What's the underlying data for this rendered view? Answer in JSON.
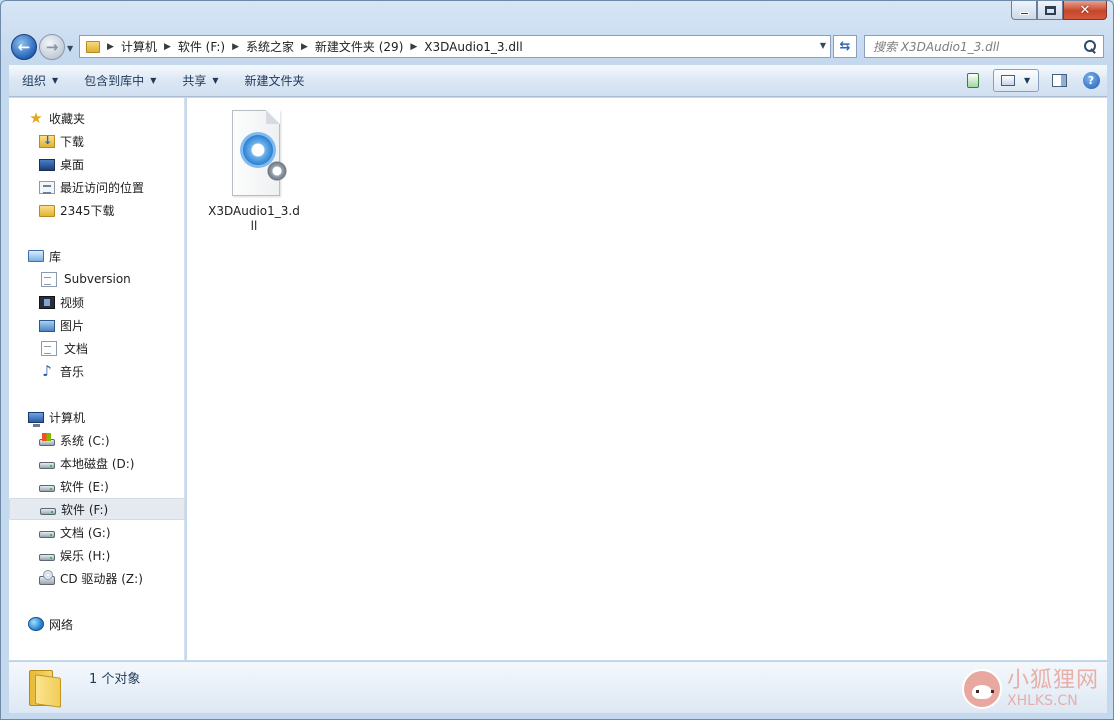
{
  "caption": {
    "min_glyph": "–",
    "max_glyph": "□",
    "close_glyph": "✕"
  },
  "address": {
    "crumbs": [
      "计算机",
      "软件 (F:)",
      "系统之家",
      "新建文件夹 (29)",
      "X3DAudio1_3.dll"
    ]
  },
  "search": {
    "placeholder": "搜索 X3DAudio1_3.dll"
  },
  "cmdbar": {
    "organize": "组织",
    "include_in_library": "包含到库中",
    "share": "共享",
    "new_folder": "新建文件夹"
  },
  "navpane": {
    "favorites": {
      "label": "收藏夹",
      "items": [
        "下载",
        "桌面",
        "最近访问的位置",
        "2345下载"
      ]
    },
    "libraries": {
      "label": "库",
      "items": [
        "Subversion",
        "视频",
        "图片",
        "文档",
        "音乐"
      ]
    },
    "computer": {
      "label": "计算机",
      "items": [
        "系统 (C:)",
        "本地磁盘 (D:)",
        "软件 (E:)",
        "软件 (F:)",
        "文档 (G:)",
        "娱乐 (H:)",
        "CD 驱动器 (Z:)"
      ],
      "selected": "软件 (F:)"
    },
    "network": {
      "label": "网络"
    }
  },
  "content": {
    "files": [
      {
        "name": "X3DAudio1_3.dll",
        "icon": "dll-gear-icon"
      }
    ]
  },
  "details": {
    "summary": "1 个对象"
  },
  "watermark": {
    "cn": "小狐狸网",
    "en": "XHLKS.CN"
  },
  "colors": {
    "accent": "#2463b8",
    "selection": "#e5eaf0",
    "window_frame": "#c4d8ee"
  }
}
